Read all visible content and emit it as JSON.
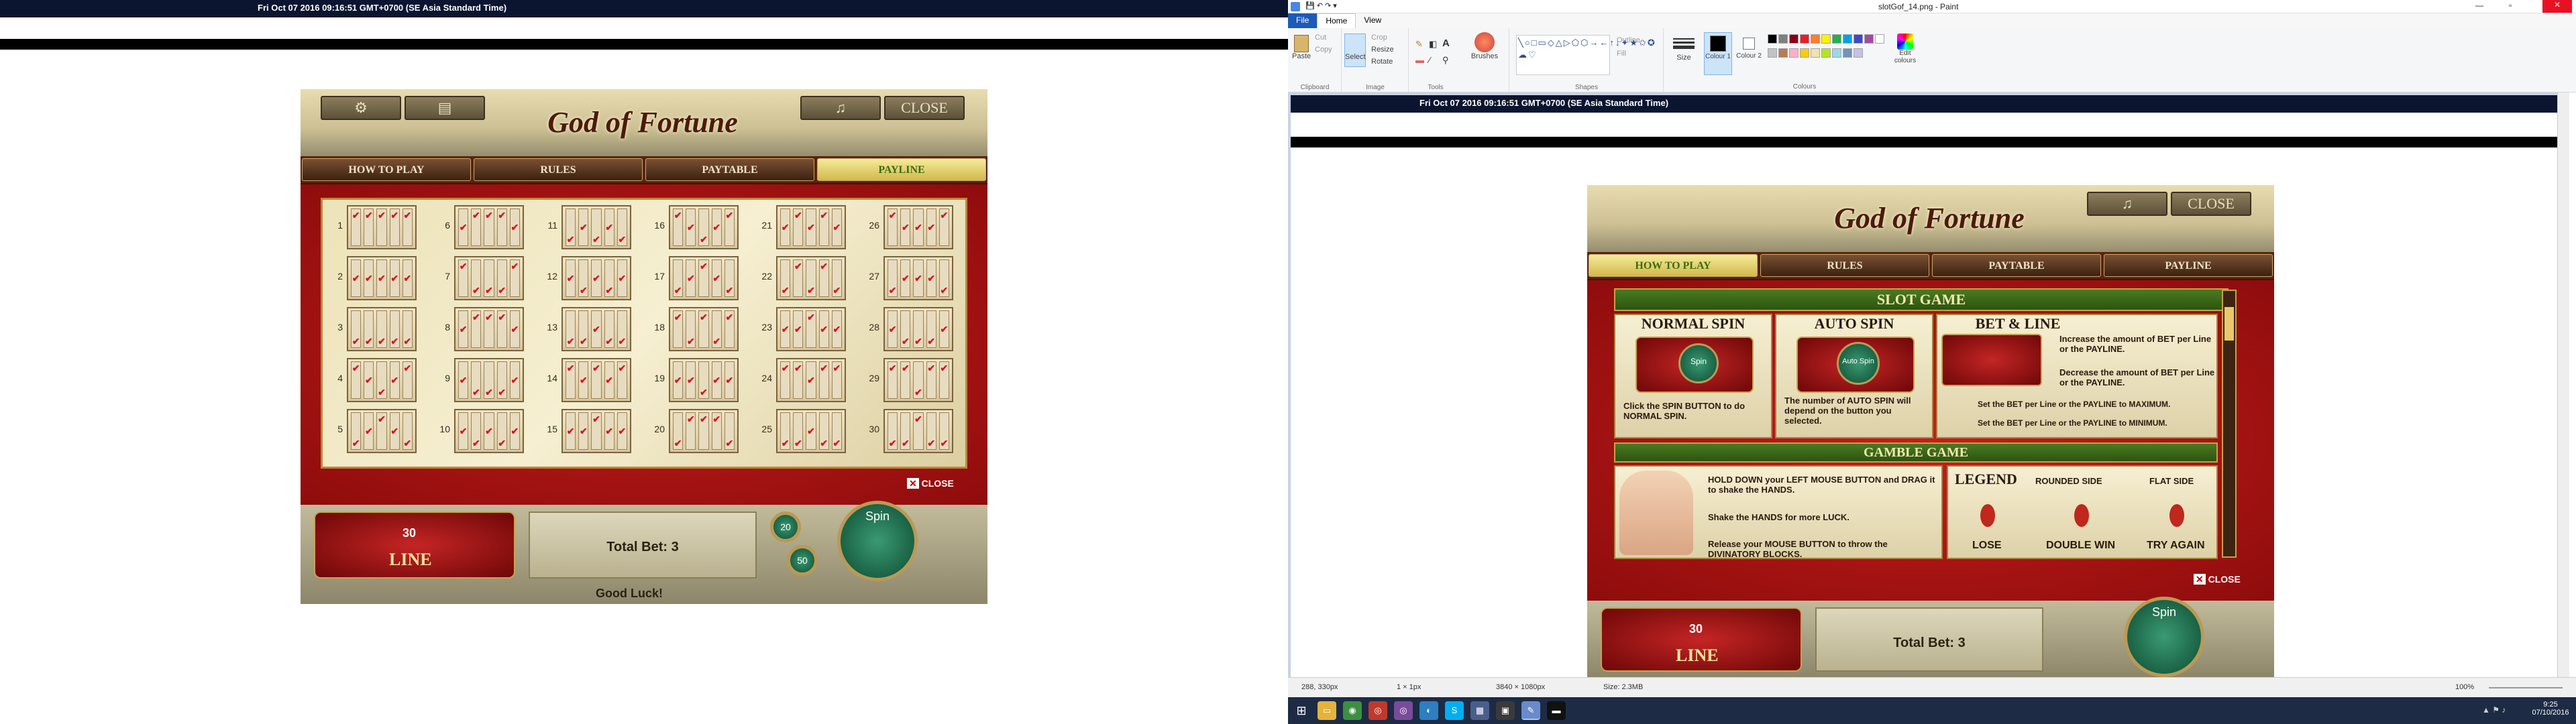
{
  "left_screen": {
    "timestamp": "Fri Oct 07 2016 09:16:51 GMT+0700 (SE Asia Standard Time)",
    "game": {
      "top_buttons": [
        "",
        ""
      ],
      "right_buttons": [
        "",
        "CLOSE"
      ],
      "logo": "God of Fortune",
      "tabs": [
        {
          "label": "HOW TO PLAY",
          "active": false
        },
        {
          "label": "RULES",
          "active": false
        },
        {
          "label": "PAYTABLE",
          "active": false
        },
        {
          "label": "PAYLINE",
          "active": true
        }
      ],
      "paylines": [
        {
          "num": "1",
          "rows": [
            0,
            0,
            0,
            0,
            0
          ]
        },
        {
          "num": "6",
          "rows": [
            1,
            0,
            0,
            0,
            1
          ]
        },
        {
          "num": "11",
          "rows": [
            2,
            1,
            2,
            1,
            2
          ]
        },
        {
          "num": "16",
          "rows": [
            0,
            1,
            2,
            1,
            0
          ]
        },
        {
          "num": "21",
          "rows": [
            1,
            0,
            1,
            0,
            1
          ]
        },
        {
          "num": "26",
          "rows": [
            0,
            1,
            1,
            1,
            0
          ]
        },
        {
          "num": "2",
          "rows": [
            1,
            1,
            1,
            1,
            1
          ]
        },
        {
          "num": "7",
          "rows": [
            0,
            2,
            2,
            2,
            0
          ]
        },
        {
          "num": "12",
          "rows": [
            1,
            2,
            1,
            2,
            1
          ]
        },
        {
          "num": "17",
          "rows": [
            2,
            1,
            0,
            1,
            2
          ]
        },
        {
          "num": "22",
          "rows": [
            2,
            0,
            2,
            0,
            2
          ]
        },
        {
          "num": "27",
          "rows": [
            2,
            1,
            1,
            1,
            2
          ]
        },
        {
          "num": "3",
          "rows": [
            2,
            2,
            2,
            2,
            2
          ]
        },
        {
          "num": "8",
          "rows": [
            1,
            0,
            0,
            0,
            1
          ]
        },
        {
          "num": "13",
          "rows": [
            2,
            2,
            1,
            2,
            2
          ]
        },
        {
          "num": "18",
          "rows": [
            0,
            2,
            0,
            2,
            0
          ]
        },
        {
          "num": "23",
          "rows": [
            1,
            1,
            0,
            1,
            1
          ]
        },
        {
          "num": "28",
          "rows": [
            1,
            2,
            2,
            2,
            1
          ]
        },
        {
          "num": "4",
          "rows": [
            0,
            1,
            2,
            1,
            0
          ]
        },
        {
          "num": "9",
          "rows": [
            1,
            2,
            2,
            2,
            1
          ]
        },
        {
          "num": "14",
          "rows": [
            0,
            1,
            0,
            1,
            0
          ]
        },
        {
          "num": "19",
          "rows": [
            1,
            1,
            2,
            1,
            1
          ]
        },
        {
          "num": "24",
          "rows": [
            0,
            0,
            1,
            0,
            0
          ]
        },
        {
          "num": "29",
          "rows": [
            0,
            0,
            2,
            0,
            0
          ]
        },
        {
          "num": "5",
          "rows": [
            2,
            1,
            0,
            1,
            2
          ]
        },
        {
          "num": "10",
          "rows": [
            1,
            2,
            1,
            2,
            1
          ]
        },
        {
          "num": "15",
          "rows": [
            1,
            1,
            0,
            1,
            1
          ]
        },
        {
          "num": "20",
          "rows": [
            2,
            0,
            0,
            0,
            2
          ]
        },
        {
          "num": "25",
          "rows": [
            2,
            2,
            1,
            2,
            2
          ]
        },
        {
          "num": "30",
          "rows": [
            2,
            2,
            0,
            2,
            2
          ]
        }
      ],
      "close_label": "CLOSE",
      "line_value": "30",
      "line_label": "LINE",
      "total_bet": "Total Bet: 3",
      "good_luck": "Good Luck!",
      "spin_label": "Spin",
      "chip_values": [
        "20",
        "50"
      ]
    }
  },
  "paint": {
    "title": "slotGof_14.png - Paint",
    "menu": [
      "File",
      "Home",
      "View"
    ],
    "ribbon": {
      "paste": "Paste",
      "cut": "Cut",
      "copy": "Copy",
      "clipboard_group": "Clipboard",
      "select": "Select",
      "crop": "Crop",
      "resize": "Resize",
      "rotate": "Rotate",
      "image_group": "Image",
      "tools_group": "Tools",
      "brushes": "Brushes",
      "outline": "Outline",
      "fill": "Fill",
      "shapes_group": "Shapes",
      "size": "Size",
      "colour1": "Colour 1",
      "colour2": "Colour 2",
      "colours_group": "Colours",
      "edit_colours": "Edit colours"
    },
    "palette": [
      "#000000",
      "#7f7f7f",
      "#880015",
      "#ed1c24",
      "#ff7f27",
      "#fff200",
      "#22b14c",
      "#00a2e8",
      "#3f48cc",
      "#a349a4",
      "#ffffff",
      "#c3c3c3",
      "#b97a57",
      "#ffaec9",
      "#ffc90e",
      "#efe4b0",
      "#b5e61d",
      "#99d9ea",
      "#7092be",
      "#c8bfe7"
    ],
    "canvas": {
      "timestamp": "Fri Oct 07 2016 09:16:51 GMT+0700 (SE Asia Standard Time)",
      "game": {
        "right_buttons": [
          "",
          "CLOSE"
        ],
        "logo": "God of Fortune",
        "tabs": [
          {
            "label": "HOW TO PLAY",
            "active": true
          },
          {
            "label": "RULES",
            "active": false
          },
          {
            "label": "PAYTABLE",
            "active": false
          },
          {
            "label": "PAYLINE",
            "active": false
          }
        ],
        "slot_game_header": "SLOT GAME",
        "normal_spin": {
          "title": "NORMAL SPIN",
          "text": "Click the SPIN BUTTON to do NORMAL SPIN.",
          "button": "Spin"
        },
        "auto_spin": {
          "title": "AUTO SPIN",
          "text": "The number of AUTO SPIN will depend on the button you selected.",
          "button": "Auto Spin"
        },
        "bet_line": {
          "title": "BET & LINE",
          "items": [
            "Increase the amount of BET per Line or the PAYLINE.",
            "Decrease the amount of BET per Line or the PAYLINE.",
            "Set the BET per Line or the PAYLINE to MAXIMUM.",
            "Set the BET per Line or the PAYLINE to MINIMUM."
          ]
        },
        "gamble_header": "GAMBLE GAME",
        "gamble_text": [
          "HOLD DOWN your LEFT MOUSE BUTTON and DRAG it to shake the HANDS.",
          "Shake the HANDS for more LUCK.",
          "Release your MOUSE BUTTON to throw the DIVINATORY BLOCKS."
        ],
        "legend": {
          "title": "LEGEND",
          "rounded": "ROUNDED SIDE",
          "flat": "FLAT SIDE",
          "lose": "LOSE",
          "double": "DOUBLE WIN",
          "try": "TRY AGAIN"
        },
        "close_label": "CLOSE",
        "line_value": "30",
        "line_label": "LINE",
        "total_bet": "Total Bet: 3",
        "spin_label": "Spin"
      }
    },
    "status": {
      "cursor": "288, 330px",
      "selection": "1 × 1px",
      "dimensions": "3840 × 1080px",
      "size": "Size: 2.3MB",
      "zoom": "100%"
    },
    "taskbar": {
      "time": "9:25",
      "date": "07/10/2016"
    }
  }
}
